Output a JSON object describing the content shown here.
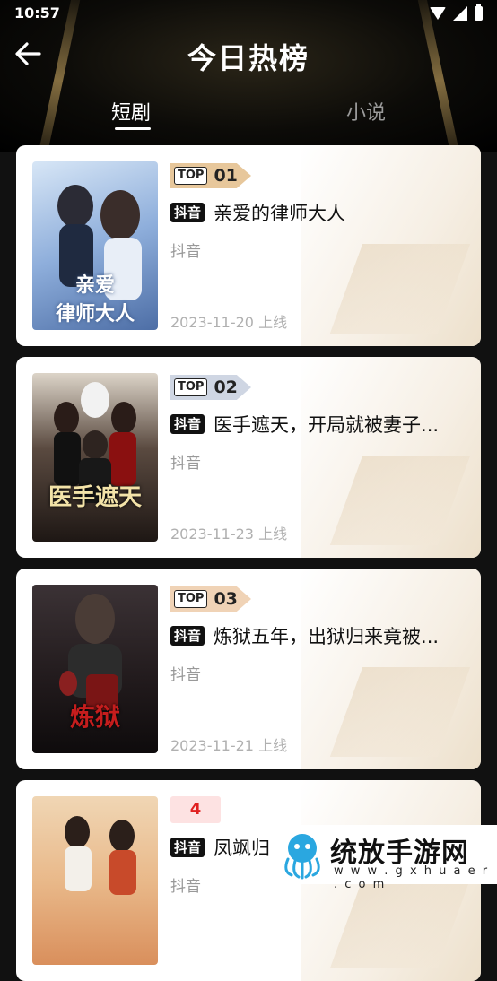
{
  "status": {
    "time": "10:57"
  },
  "header": {
    "title": "今日热榜"
  },
  "tabs": [
    {
      "label": "短剧"
    },
    {
      "label": "小说"
    }
  ],
  "items": [
    {
      "rank_top": "TOP",
      "rank": "01",
      "tag": "抖音",
      "title": "亲爱的律师大人",
      "platform": "抖音",
      "date": "2023-11-20 上线",
      "poster_text": "亲爱\n律师大人",
      "poster_color": "#a9c3e6",
      "badge_color": "#e7c79b"
    },
    {
      "rank_top": "TOP",
      "rank": "02",
      "tag": "抖音",
      "title": "医手遮天，开局就被妻子...",
      "platform": "抖音",
      "date": "2023-11-23 上线",
      "poster_text": "医手遮天",
      "poster_color": "#3a3130",
      "badge_color": "#cfd6e3"
    },
    {
      "rank_top": "TOP",
      "rank": "03",
      "tag": "抖音",
      "title": "炼狱五年，出狱归来竟被...",
      "platform": "抖音",
      "date": "2023-11-21 上线",
      "poster_text": "炼狱",
      "poster_color": "#2a2426",
      "badge_color": "#f0d3b6"
    },
    {
      "rank": "4",
      "tag": "抖音",
      "title": "凤飒归",
      "platform": "抖音",
      "poster_color": "#e9c39b"
    }
  ],
  "watermark": {
    "text": "统放手游网",
    "url": "w w w . g x h u a e r . c o m"
  }
}
